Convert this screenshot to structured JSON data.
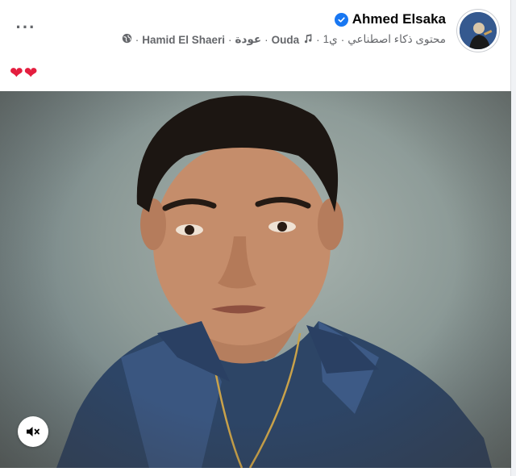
{
  "post": {
    "author_name": "Ahmed Elsaka",
    "meta": {
      "ai_label": "محتوى ذكاء اصطناعي",
      "age": "1ي",
      "song_title": "Ouda",
      "song_title_ar": "عودة",
      "artist": "Hamid El Shaeri",
      "separator": "·"
    },
    "reactions": [
      "heart",
      "heart"
    ],
    "media": {
      "type": "video",
      "muted": true
    }
  },
  "colors": {
    "accent": "#1877f2",
    "heart": "#e41e3f",
    "secondary_text": "#65676b"
  }
}
